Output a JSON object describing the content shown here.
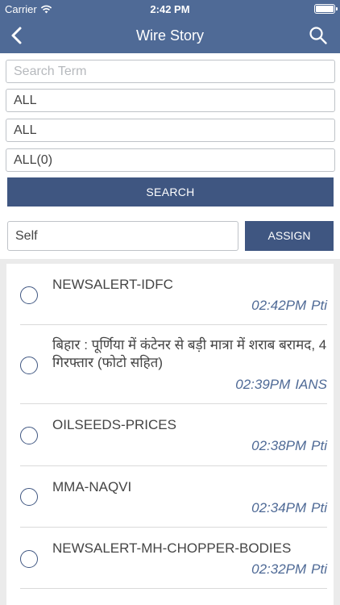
{
  "status_bar": {
    "carrier": "Carrier",
    "time": "2:42 PM"
  },
  "nav": {
    "title": "Wire Story",
    "back_icon": "chevron-left-icon",
    "search_icon": "search-icon"
  },
  "filters": {
    "search_placeholder": "Search Term",
    "filter1": "ALL",
    "filter2": "ALL",
    "filter3": "ALL(0)",
    "search_button": "SEARCH"
  },
  "assign": {
    "value": "Self",
    "button": "ASSIGN"
  },
  "stories": [
    {
      "title": "NEWSALERT-IDFC",
      "time": "02:42PM",
      "source": "Pti"
    },
    {
      "title": "बिहार : पूर्णिया में कंटेनर से बड़ी मात्रा में शराब बरामद, 4 गिरफ्तार (फोटो सहित)",
      "time": "02:39PM",
      "source": "IANS"
    },
    {
      "title": "OILSEEDS-PRICES",
      "time": "02:38PM",
      "source": "Pti"
    },
    {
      "title": "MMA-NAQVI",
      "time": "02:34PM",
      "source": "Pti"
    },
    {
      "title": "NEWSALERT-MH-CHOPPER-BODIES",
      "time": "02:32PM",
      "source": "Pti"
    }
  ],
  "colors": {
    "accent": "#4f6a96",
    "button": "#3f5681"
  }
}
